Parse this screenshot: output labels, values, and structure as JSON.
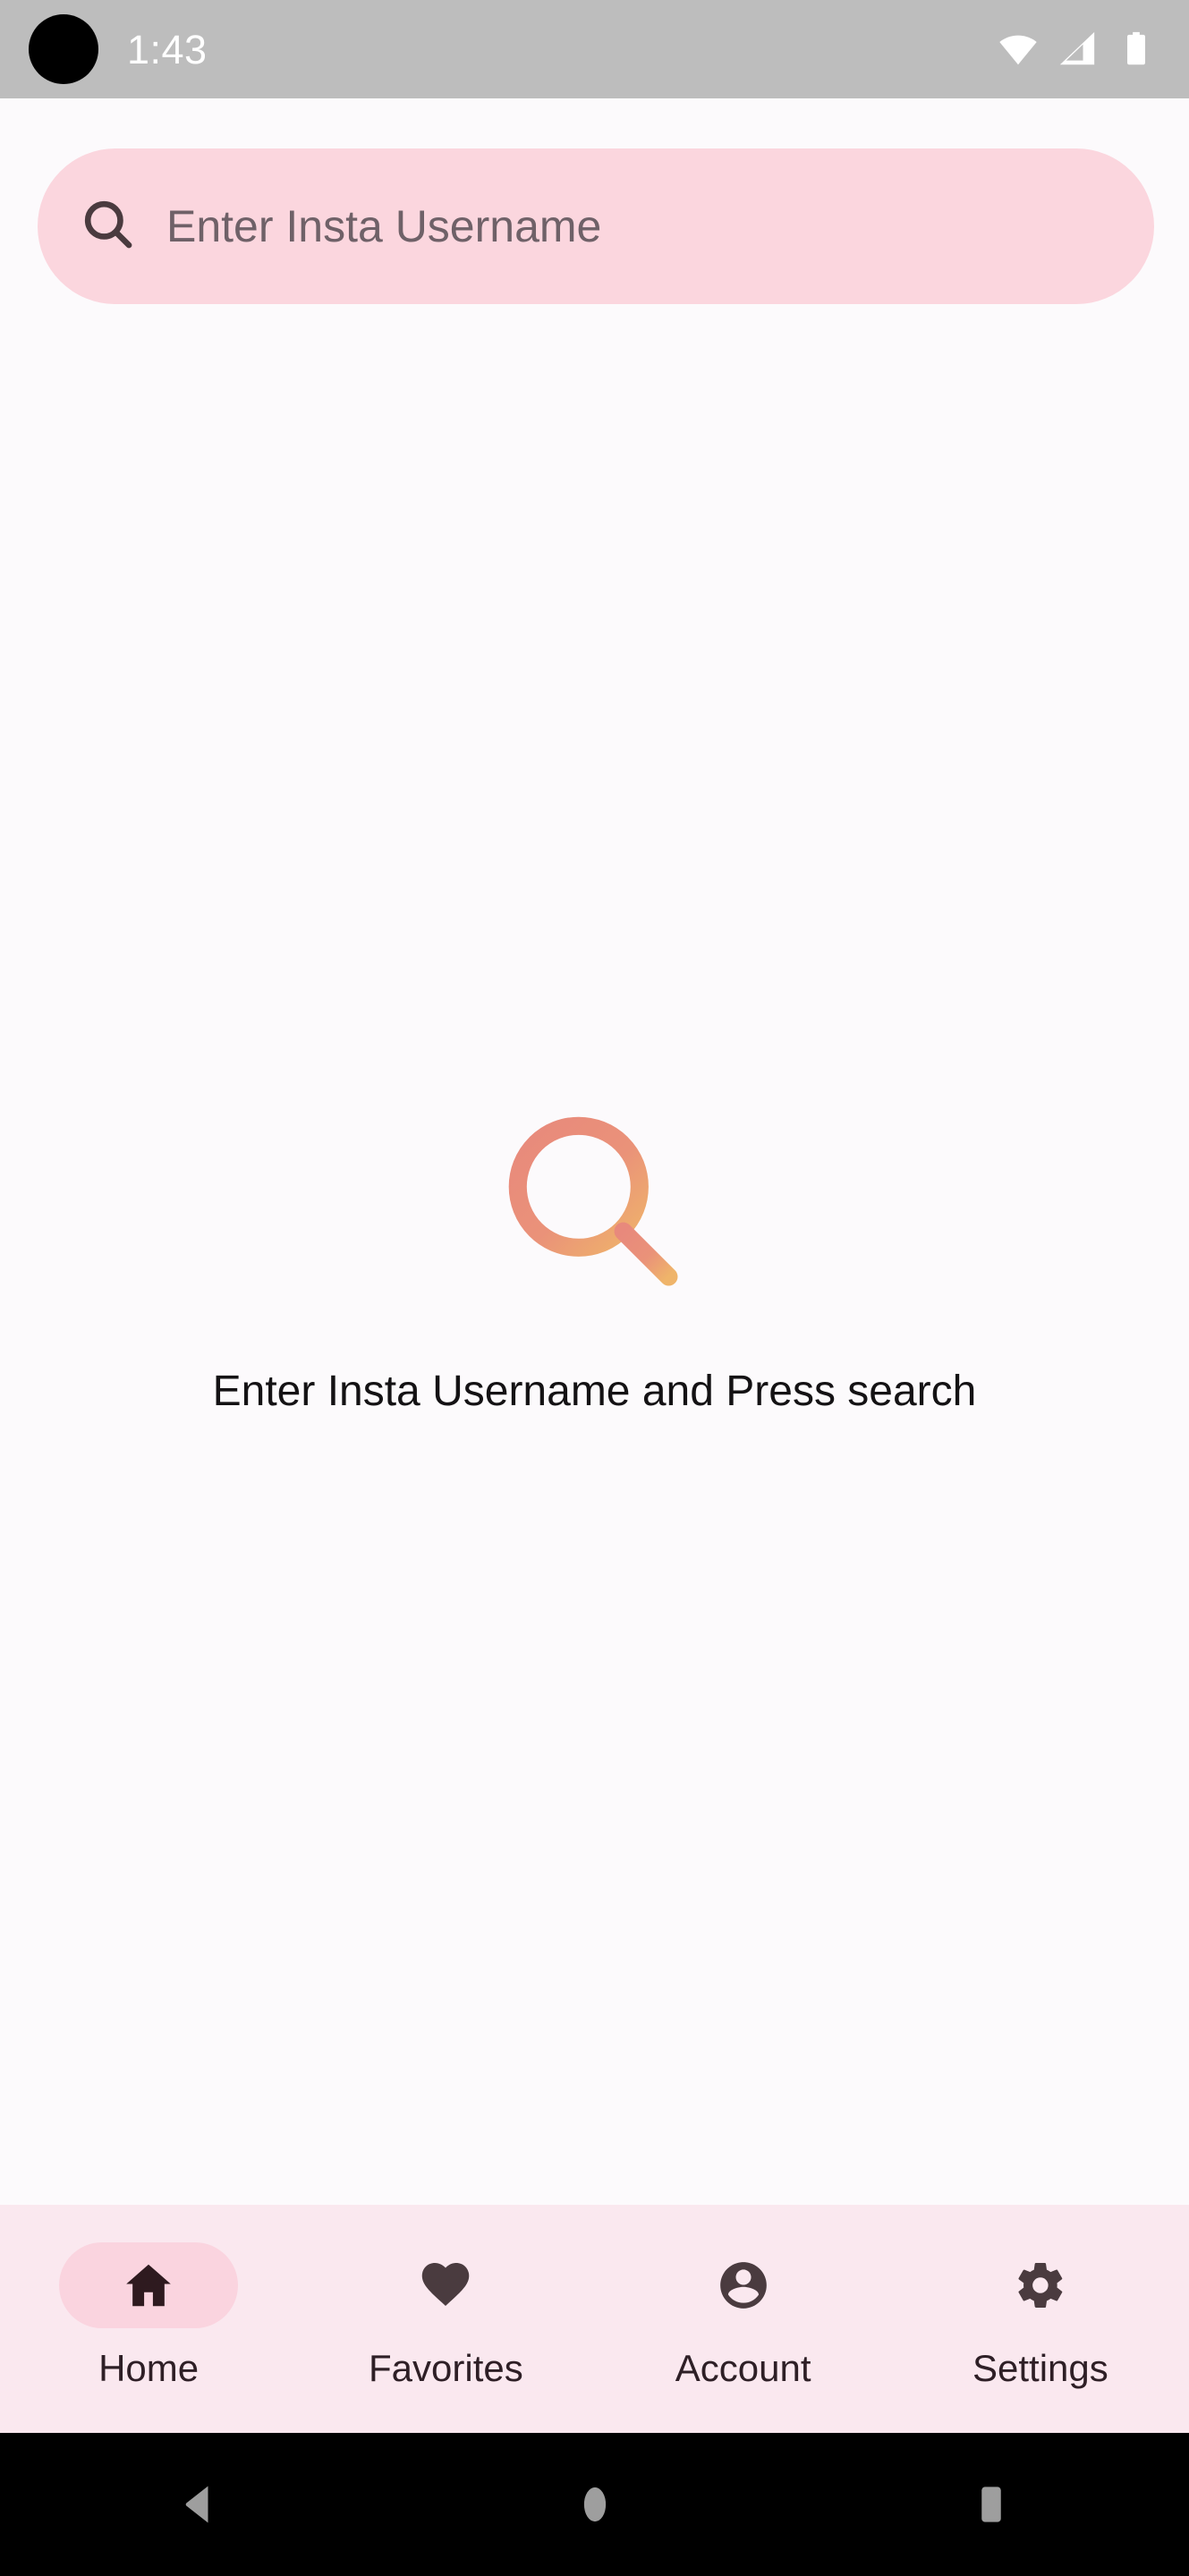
{
  "status_bar": {
    "time": "1:43",
    "background_color": "#BDBDBD",
    "text_color": "#FFFFFF",
    "icons": [
      "wifi-icon",
      "cellular-signal-icon",
      "battery-icon"
    ]
  },
  "search": {
    "placeholder": "Enter Insta Username",
    "value": "",
    "icon": "search-icon",
    "background_color": "#FBD6DE"
  },
  "empty_state": {
    "icon": "magnifier-illustration",
    "message": "Enter Insta Username and Press search",
    "gradient_start_color": "#E8897C",
    "gradient_end_color": "#EFB46A"
  },
  "bottom_nav": {
    "background_color": "#FAE8EF",
    "selected_pill_color": "#FAD4DF",
    "icon_color": "#4A3B3F",
    "items": [
      {
        "label": "Home",
        "icon": "home-icon",
        "selected": true
      },
      {
        "label": "Favorites",
        "icon": "heart-icon",
        "selected": false
      },
      {
        "label": "Account",
        "icon": "account-icon",
        "selected": false
      },
      {
        "label": "Settings",
        "icon": "gear-icon",
        "selected": false
      }
    ]
  },
  "android_nav": {
    "background_color": "#000000",
    "icon_color": "#9E9E9E",
    "buttons": [
      {
        "name": "back-button",
        "icon": "triangle-back-icon"
      },
      {
        "name": "home-button",
        "icon": "circle-home-icon"
      },
      {
        "name": "recents-button",
        "icon": "square-recents-icon"
      }
    ]
  },
  "page_background_color": "#FCFAFC"
}
